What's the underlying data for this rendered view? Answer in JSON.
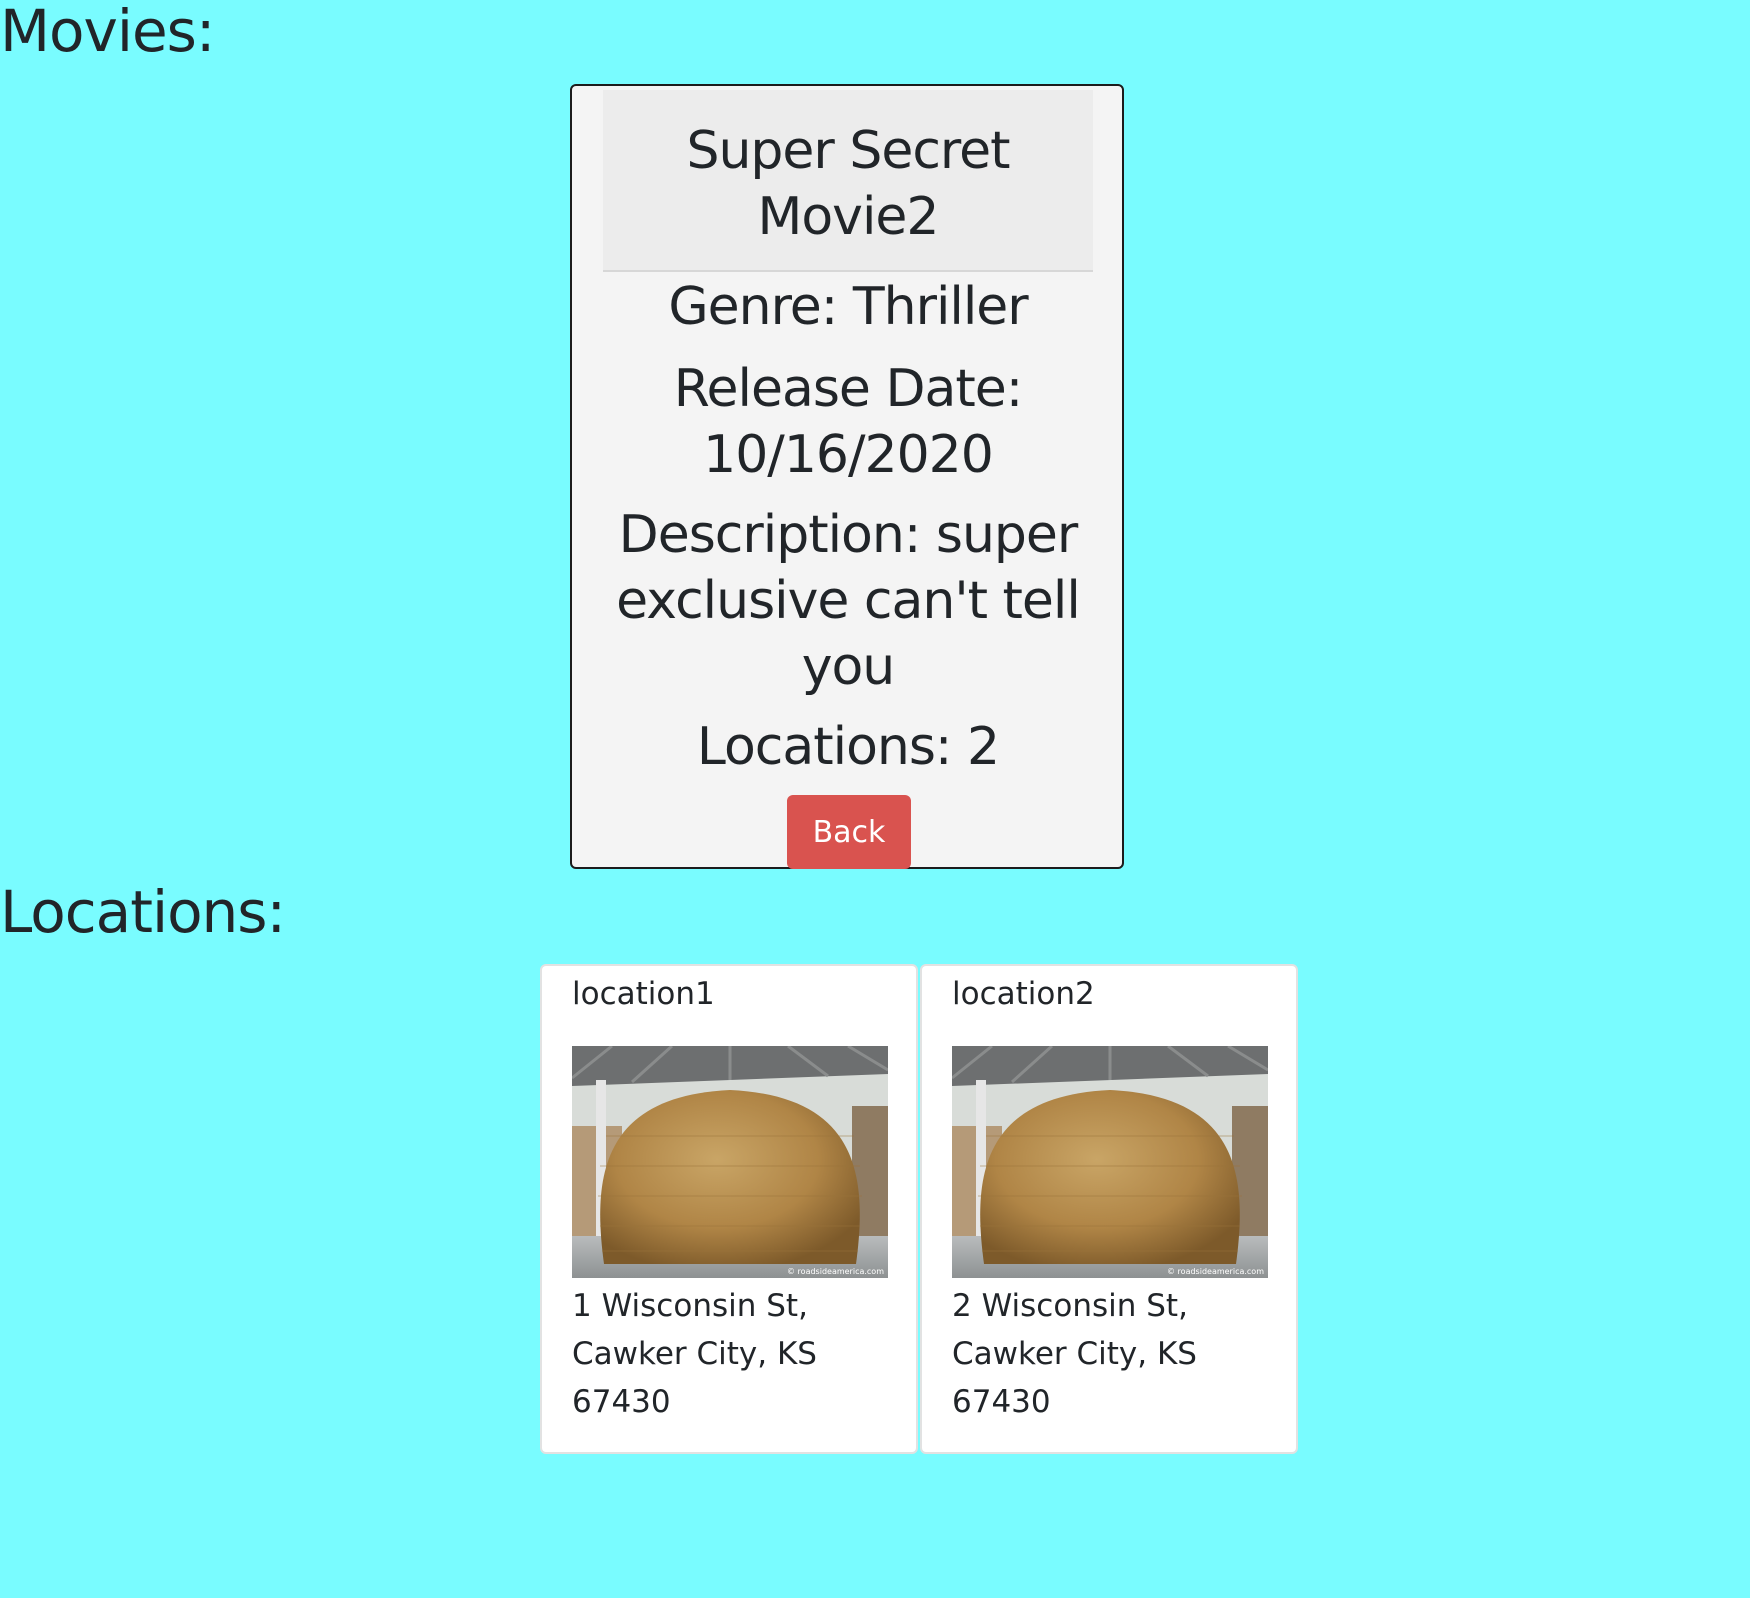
{
  "movies_heading": "Movies:",
  "locations_heading": "Locations:",
  "movie": {
    "title": "Super Secret Movie2",
    "genre": "Genre: Thriller",
    "release_date": "Release Date: 10/16/2020",
    "description": "Description: super exclusive can't tell you",
    "locations_count": "Locations: 2",
    "back_label": "Back"
  },
  "locations": [
    {
      "name": "location1",
      "address": "1 Wisconsin St, Cawker City, KS 67430",
      "photo_credit": "© roadsideamerica.com"
    },
    {
      "name": "location2",
      "address": "2 Wisconsin St, Cawker City, KS 67430",
      "photo_credit": "© roadsideamerica.com"
    }
  ],
  "colors": {
    "background": "#79fcff",
    "back_button": "#d9534f",
    "card_background": "#f4f4f4"
  }
}
